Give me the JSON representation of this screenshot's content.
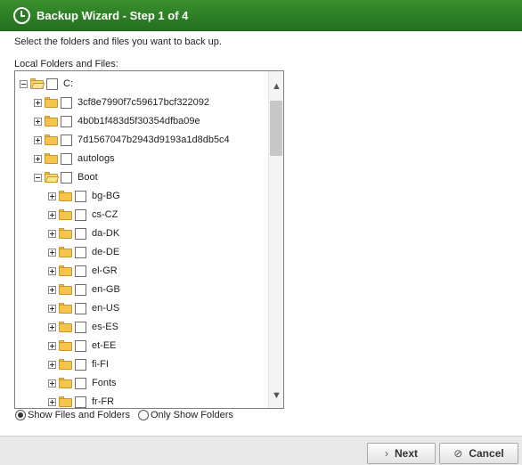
{
  "window": {
    "title": "Backup Wizard - Step 1 of 4",
    "icon": "backup-clock-icon"
  },
  "instruction": "Select the folders and files you want to back up.",
  "tree_label": "Local Folders and Files:",
  "tree": [
    {
      "label": "C:",
      "level": 0,
      "expanded": true,
      "folder_open": true
    },
    {
      "label": "3cf8e7990f7c59617bcf322092",
      "level": 1,
      "expanded": false,
      "folder_open": false
    },
    {
      "label": "4b0b1f483d5f30354dfba09e",
      "level": 1,
      "expanded": false,
      "folder_open": false
    },
    {
      "label": "7d1567047b2943d9193a1d8db5c4",
      "level": 1,
      "expanded": false,
      "folder_open": false
    },
    {
      "label": "autologs",
      "level": 1,
      "expanded": false,
      "folder_open": false
    },
    {
      "label": "Boot",
      "level": 1,
      "expanded": true,
      "folder_open": true
    },
    {
      "label": "bg-BG",
      "level": 2,
      "expanded": false,
      "folder_open": false
    },
    {
      "label": "cs-CZ",
      "level": 2,
      "expanded": false,
      "folder_open": false
    },
    {
      "label": "da-DK",
      "level": 2,
      "expanded": false,
      "folder_open": false
    },
    {
      "label": "de-DE",
      "level": 2,
      "expanded": false,
      "folder_open": false
    },
    {
      "label": "el-GR",
      "level": 2,
      "expanded": false,
      "folder_open": false
    },
    {
      "label": "en-GB",
      "level": 2,
      "expanded": false,
      "folder_open": false
    },
    {
      "label": "en-US",
      "level": 2,
      "expanded": false,
      "folder_open": false
    },
    {
      "label": "es-ES",
      "level": 2,
      "expanded": false,
      "folder_open": false
    },
    {
      "label": "et-EE",
      "level": 2,
      "expanded": false,
      "folder_open": false
    },
    {
      "label": "fi-FI",
      "level": 2,
      "expanded": false,
      "folder_open": false
    },
    {
      "label": "Fonts",
      "level": 2,
      "expanded": false,
      "folder_open": false
    },
    {
      "label": "fr-FR",
      "level": 2,
      "expanded": false,
      "folder_open": false
    }
  ],
  "view_options": {
    "show_files_and_folders": "Show Files and Folders",
    "only_show_folders": "Only Show Folders",
    "selected": "show_files_and_folders"
  },
  "buttons": {
    "next": "Next",
    "cancel": "Cancel"
  },
  "colors": {
    "title_bar": "#2e8128",
    "folder": "#f5c44a"
  }
}
